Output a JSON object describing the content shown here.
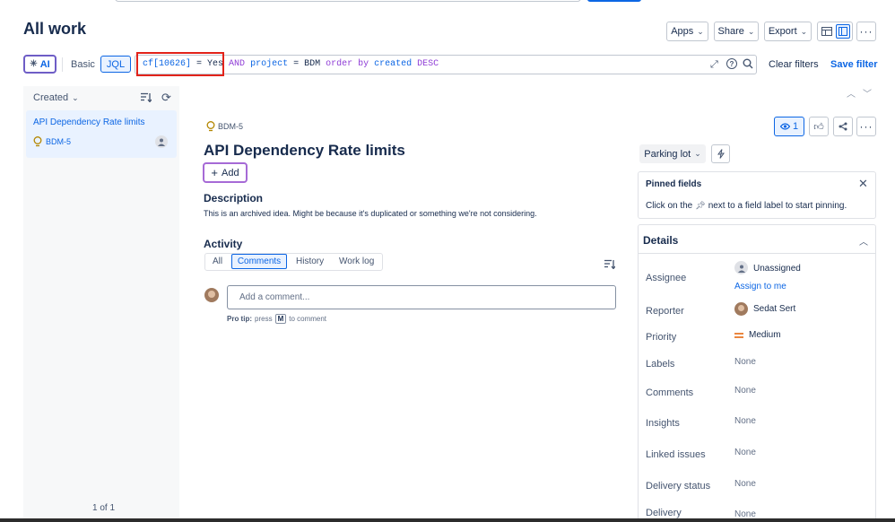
{
  "page": {
    "title": "All work"
  },
  "header": {
    "apps_label": "Apps",
    "share_label": "Share",
    "export_label": "Export"
  },
  "filter_bar": {
    "ai_label": "AI",
    "basic_label": "Basic",
    "jql_label": "JQL",
    "jql_part1": "cf[10626]",
    "jql_eq1": "=",
    "jql_yes": "Yes",
    "jql_and": "AND",
    "jql_project": "project",
    "jql_eq2": "=",
    "jql_bdm": "BDM",
    "jql_order": "order",
    "jql_by": "by",
    "jql_created": "created",
    "jql_desc": "DESC",
    "clear_filters": "Clear filters",
    "save_filter": "Save filter"
  },
  "list": {
    "sort_label": "Created",
    "items": [
      {
        "title": "API Dependency Rate limits",
        "key": "BDM-5"
      }
    ],
    "pagination": "1 of 1"
  },
  "issue": {
    "key": "BDM-5",
    "title": "API Dependency Rate limits",
    "add_label": "Add",
    "description_heading": "Description",
    "description_text": "This is an archived idea. Might be because it's duplicated or something we're not considering.",
    "watch_count": "1"
  },
  "activity": {
    "heading": "Activity",
    "tabs": [
      "All",
      "Comments",
      "History",
      "Work log"
    ],
    "comment_placeholder": "Add a comment...",
    "pro_tip_bold": "Pro tip:",
    "pro_tip_press": "press",
    "pro_tip_key": "M",
    "pro_tip_rest": "to comment"
  },
  "status": {
    "label": "Parking lot"
  },
  "pinned": {
    "heading": "Pinned fields",
    "text_before": "Click on the",
    "text_after": "next to a field label to start pinning."
  },
  "details": {
    "heading": "Details",
    "assignee_label": "Assignee",
    "assignee_value": "Unassigned",
    "assign_to_me": "Assign to me",
    "reporter_label": "Reporter",
    "reporter_value": "Sedat Sert",
    "priority_label": "Priority",
    "priority_value": "Medium",
    "labels_label": "Labels",
    "labels_value": "None",
    "comments_label": "Comments",
    "comments_value": "None",
    "insights_label": "Insights",
    "insights_value": "None",
    "linked_label": "Linked issues",
    "linked_value": "None",
    "delivery_status_label": "Delivery status",
    "delivery_status_value": "None",
    "delivery_label": "Delivery",
    "delivery_value": "None"
  },
  "colors": {
    "accent": "#0c66e4",
    "ai_border": "#6e5dc6",
    "highlight_red": "#e2231a",
    "jql_keyword": "#8f3dd6",
    "priority_orange": "#e56910",
    "idea_yellow": "#b38600"
  }
}
